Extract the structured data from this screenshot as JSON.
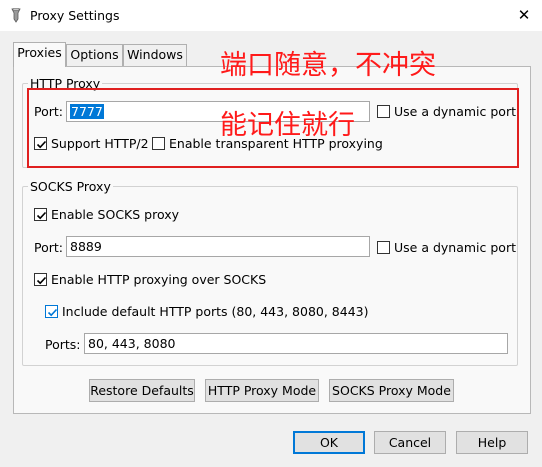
{
  "window": {
    "title": "Proxy Settings",
    "close_glyph": "✕"
  },
  "tabs": [
    {
      "label": "Proxies",
      "active": true
    },
    {
      "label": "Options",
      "active": false
    },
    {
      "label": "Windows",
      "active": false
    }
  ],
  "http_proxy": {
    "title": "HTTP Proxy",
    "port_label": "Port:",
    "port_value": "7777",
    "dynamic_port_label": "Use a dynamic port",
    "dynamic_port_checked": false,
    "http2_label": "Support HTTP/2",
    "http2_checked": true,
    "transparent_label": "Enable transparent HTTP proxying",
    "transparent_checked": false
  },
  "socks_proxy": {
    "title": "SOCKS Proxy",
    "enable_label": "Enable SOCKS proxy",
    "enable_checked": true,
    "port_label": "Port:",
    "port_value": "8889",
    "dynamic_port_label": "Use a dynamic port",
    "dynamic_port_checked": false,
    "http_over_socks_label": "Enable HTTP proxying over SOCKS",
    "http_over_socks_checked": true,
    "include_default_ports_label": "Include default HTTP ports (80, 443, 8080, 8443)",
    "include_default_ports_checked": true,
    "ports_label": "Ports:",
    "ports_value": "80, 443, 8080"
  },
  "panel_buttons": {
    "restore_defaults": "Restore Defaults",
    "http_proxy_mode": "HTTP Proxy Mode",
    "socks_proxy_mode": "SOCKS Proxy Mode"
  },
  "dialog_buttons": {
    "ok": "OK",
    "cancel": "Cancel",
    "help": "Help"
  },
  "annotation": {
    "line1": "端口随意，不冲突",
    "line2": "能记住就行",
    "color": "#ff1a1a"
  },
  "colors": {
    "accent": "#0078d7",
    "annotation_box": "#e02020"
  }
}
